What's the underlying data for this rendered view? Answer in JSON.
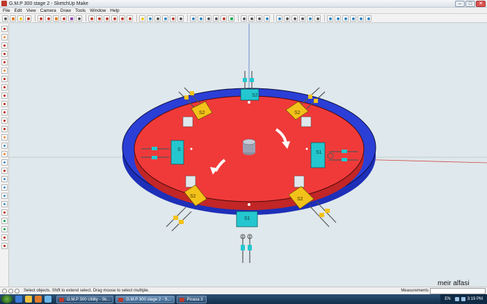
{
  "window": {
    "title": "G.M.P 300 stage 2 - SketchUp Make",
    "min_label": "–",
    "max_label": "□",
    "close_label": "✕"
  },
  "menu": [
    "File",
    "Edit",
    "View",
    "Camera",
    "Draw",
    "Tools",
    "Window",
    "Help"
  ],
  "model": {
    "station_labels": {
      "top": "S2",
      "top_right": "S2",
      "right": "S1",
      "bottom_right": "S2",
      "bottom": "S1",
      "bottom_left": "S2",
      "left": "S",
      "top_left": "S2"
    },
    "colors": {
      "table": "#f03a3a",
      "ring": "#2b3fd6",
      "station_cyan": "#24c7cf",
      "station_yellow": "#f3c21a",
      "background": "#dfe8ec"
    }
  },
  "status": {
    "message": "Select objects. Shift to extend select. Drag mouse to select multiple.",
    "measurements_label": "Measurements",
    "measurements_value": ""
  },
  "watermark": "meir alfasi",
  "taskbar": {
    "tasks": [
      {
        "label": "G.M.P 300 Utility - Sk...",
        "active": false
      },
      {
        "label": "G.M.P 300 stage 2 - S...",
        "active": true
      },
      {
        "label": "Picasa 3",
        "active": false
      }
    ],
    "language": "EN",
    "clock": "3:19 PM"
  }
}
